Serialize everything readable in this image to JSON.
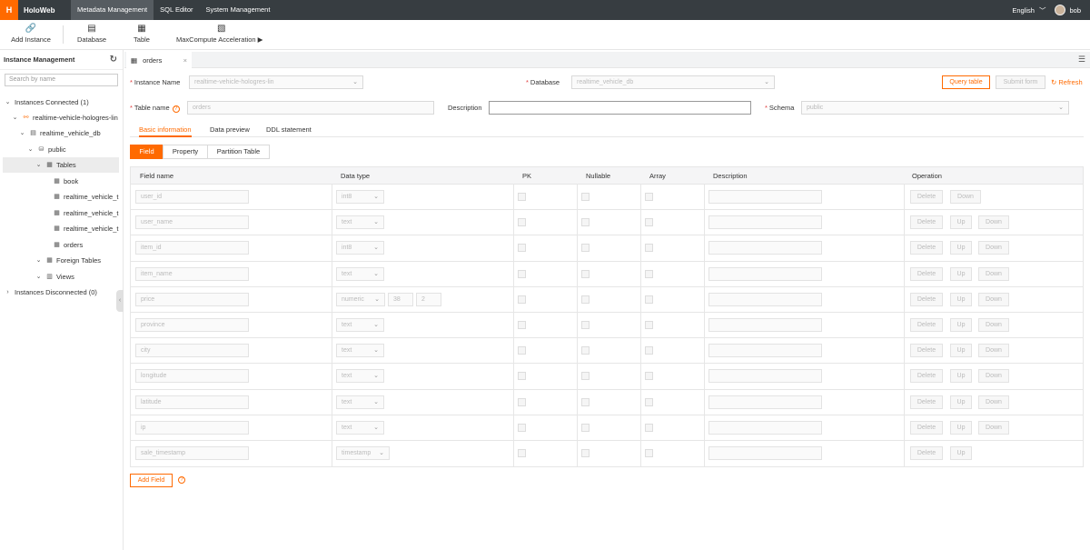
{
  "topbar": {
    "logo": "HoloWeb",
    "nav": [
      "Metadata Management",
      "SQL Editor",
      "System Management"
    ],
    "active_nav": "Metadata Management",
    "language": "English",
    "user": "bob"
  },
  "toolbar": {
    "add_instance": "Add Instance",
    "database": "Database",
    "table": "Table",
    "maxcompute": "MaxCompute Acceleration"
  },
  "sidebar": {
    "title": "Instance Management",
    "search_placeholder": "Search by name",
    "tree": {
      "connected": "Instances Connected (1)",
      "instance": "realtime-vehicle-hologres-lin",
      "database": "realtime_vehicle_db",
      "schema": "public",
      "tables": "Tables",
      "table_items": [
        "book",
        "realtime_vehicle_t",
        "realtime_vehicle_t",
        "realtime_vehicle_t",
        "orders"
      ],
      "foreign_tables": "Foreign Tables",
      "views": "Views",
      "disconnected": "Instances Disconnected (0)"
    }
  },
  "tab": {
    "label": "orders"
  },
  "form": {
    "instance_label": "Instance Name",
    "instance_value": "realtime-vehicle-hologres-lin",
    "database_label": "Database",
    "database_value": "realtime_vehicle_db",
    "query_table": "Query table",
    "submit_form": "Submit form",
    "refresh": "Refresh",
    "table_name_label": "Table name",
    "table_name_value": "orders",
    "description_label": "Description",
    "description_value": "",
    "schema_label": "Schema",
    "schema_value": "public"
  },
  "subtabs": [
    "Basic information",
    "Data preview",
    "DDL statement"
  ],
  "segments": [
    "Field",
    "Property",
    "Partition Table"
  ],
  "columns": [
    "Field name",
    "Data type",
    "PK",
    "Nullable",
    "Array",
    "Description",
    "Operation"
  ],
  "fields": [
    {
      "name": "user_id",
      "type": "int8",
      "ops": [
        "Delete",
        "Down"
      ]
    },
    {
      "name": "user_name",
      "type": "text",
      "ops": [
        "Delete",
        "Up",
        "Down"
      ]
    },
    {
      "name": "item_id",
      "type": "int8",
      "ops": [
        "Delete",
        "Up",
        "Down"
      ]
    },
    {
      "name": "item_name",
      "type": "text",
      "ops": [
        "Delete",
        "Up",
        "Down"
      ]
    },
    {
      "name": "price",
      "type": "numeric",
      "precision": "38",
      "scale": "2",
      "ops": [
        "Delete",
        "Up",
        "Down"
      ]
    },
    {
      "name": "province",
      "type": "text",
      "ops": [
        "Delete",
        "Up",
        "Down"
      ]
    },
    {
      "name": "city",
      "type": "text",
      "ops": [
        "Delete",
        "Up",
        "Down"
      ]
    },
    {
      "name": "longitude",
      "type": "text",
      "ops": [
        "Delete",
        "Up",
        "Down"
      ]
    },
    {
      "name": "latitude",
      "type": "text",
      "ops": [
        "Delete",
        "Up",
        "Down"
      ]
    },
    {
      "name": "ip",
      "type": "text",
      "ops": [
        "Delete",
        "Up",
        "Down"
      ]
    },
    {
      "name": "sale_timestamp",
      "type": "timestamp",
      "ops": [
        "Delete",
        "Up"
      ]
    }
  ],
  "add_field": "Add Field",
  "colors": {
    "accent": "#ff6a00",
    "topbar": "#373d41"
  }
}
